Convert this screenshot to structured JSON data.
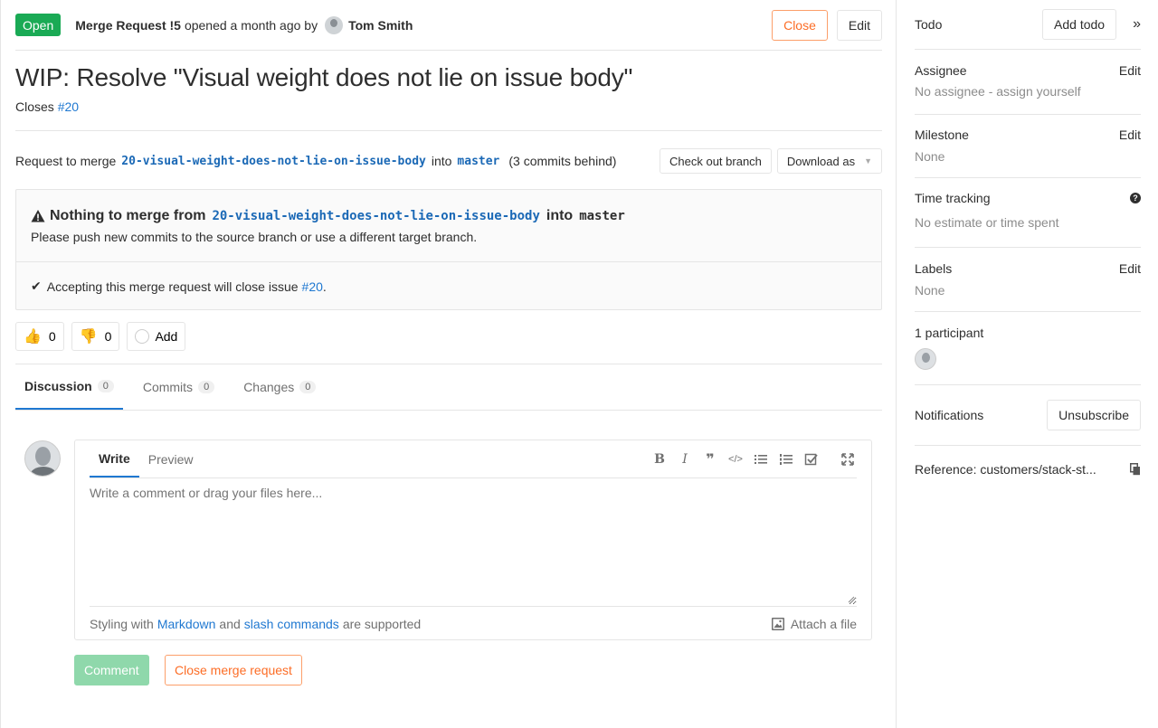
{
  "header": {
    "status": "Open",
    "mr_ref": "Merge Request !5",
    "opened_text": "opened a month ago by",
    "author": "Tom Smith",
    "close_label": "Close",
    "edit_label": "Edit"
  },
  "title": "WIP: Resolve \"Visual weight does not lie on issue body\"",
  "closes": {
    "prefix": "Closes",
    "issue": "#20"
  },
  "merge_info": {
    "prefix": "Request to merge",
    "source_branch": "20-visual-weight-does-not-lie-on-issue-body",
    "into": "into",
    "target_branch": "master",
    "behind": "(3 commits behind)",
    "checkout_label": "Check out branch",
    "download_label": "Download as"
  },
  "widget": {
    "title_prefix": "Nothing to merge from",
    "source_branch": "20-visual-weight-does-not-lie-on-issue-body",
    "into": "into",
    "target_branch": "master",
    "subtitle": "Please push new commits to the source branch or use a different target branch.",
    "accept_text": "Accepting this merge request will close issue",
    "accept_issue": "#20",
    "accept_suffix": "."
  },
  "awards": {
    "thumbs_up_count": "0",
    "thumbs_down_count": "0",
    "add_label": "Add"
  },
  "tabs": [
    {
      "label": "Discussion",
      "count": "0"
    },
    {
      "label": "Commits",
      "count": "0"
    },
    {
      "label": "Changes",
      "count": "0"
    }
  ],
  "comment": {
    "write_tab": "Write",
    "preview_tab": "Preview",
    "placeholder": "Write a comment or drag your files here...",
    "footer_prefix": "Styling with",
    "markdown_link": "Markdown",
    "and": "and",
    "slash_link": "slash commands",
    "footer_suffix": "are supported",
    "attach_label": "Attach a file",
    "comment_button": "Comment",
    "close_button": "Close merge request"
  },
  "sidebar": {
    "todo_label": "Todo",
    "add_todo": "Add todo",
    "assignee_label": "Assignee",
    "assignee_edit": "Edit",
    "assignee_value": "No assignee - assign yourself",
    "milestone_label": "Milestone",
    "milestone_edit": "Edit",
    "milestone_value": "None",
    "time_label": "Time tracking",
    "time_value": "No estimate or time spent",
    "labels_label": "Labels",
    "labels_edit": "Edit",
    "labels_value": "None",
    "participants_label": "1 participant",
    "notifications_label": "Notifications",
    "unsubscribe": "Unsubscribe",
    "reference": "Reference: customers/stack-st..."
  },
  "colors": {
    "open_badge": "#1aaa55",
    "link": "#1f78d1",
    "close_orange": "#fc6d26",
    "comment_green": "#8fd8ab"
  }
}
